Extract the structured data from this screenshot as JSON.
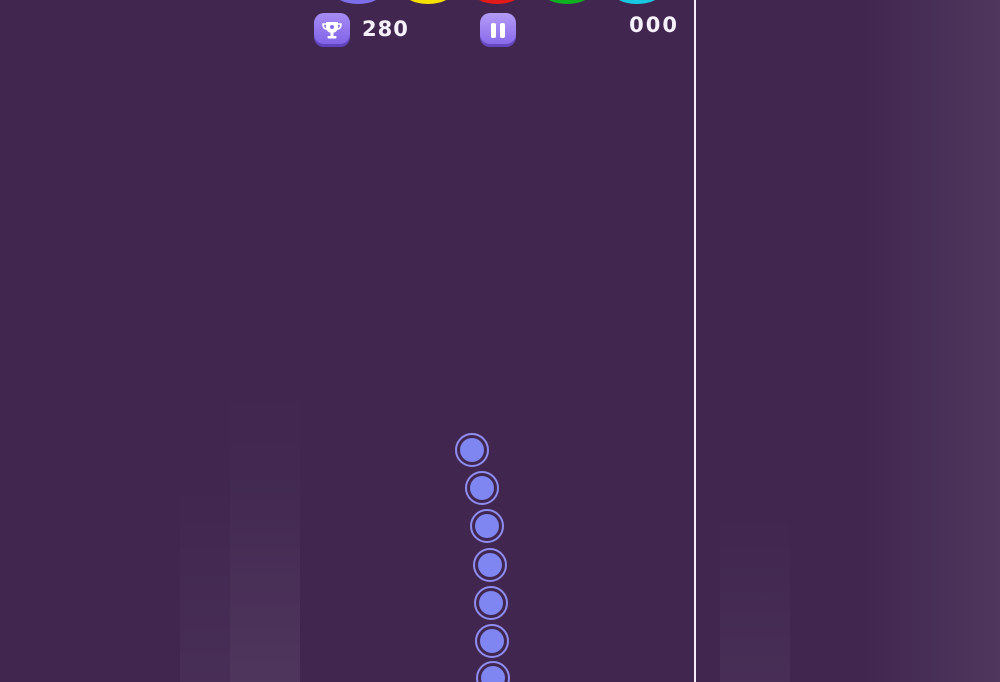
{
  "hud": {
    "best_score": "280",
    "counter": "000",
    "trophy_icon": "trophy-icon",
    "pause_icon": "pause-icon"
  },
  "rings": [
    {
      "color": "#7b6ee8"
    },
    {
      "color": "#f5e000"
    },
    {
      "color": "#e21a1a"
    },
    {
      "color": "#10b020"
    },
    {
      "color": "#18c8e0"
    }
  ],
  "snake": {
    "ball_count": 7,
    "color": "#7f86f2"
  },
  "colors": {
    "background": "#412750",
    "divider": "#f4eef8"
  }
}
